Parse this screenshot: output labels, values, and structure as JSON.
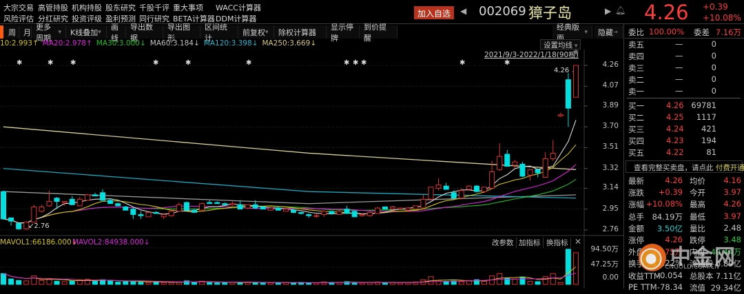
{
  "menu_row1": [
    "大宗交易",
    "高管持股",
    "机构持股",
    "股东研究",
    "千股千评",
    "重大事项",
    "WACC计算器"
  ],
  "menu_row2": [
    "风险评估",
    "分红研究",
    "投资评级",
    "盈利预测",
    "同行研究",
    "BETA计算器",
    "DDM计算器"
  ],
  "header": {
    "add_watch": "加入自选",
    "code": "002069",
    "name": "獐子岛",
    "price": "4.26",
    "change": "+0.39",
    "change_pct": "+10.08%"
  },
  "toolbar": {
    "items": [
      "周",
      "月",
      "更多周期",
      "K线叠加",
      "画线",
      "导出数据",
      "导出图形",
      "区间统计",
      "前复权",
      "除权计算器",
      "显示停牌",
      "到价提醒"
    ],
    "layout": "经典版面",
    "hide": "隐藏"
  },
  "ma_legend": [
    {
      "text": "10:2.993↑",
      "color": "#d4c400"
    },
    {
      "text": "MA20:2.978↑",
      "color": "#e020e0"
    },
    {
      "text": "MA30:3.000↓",
      "color": "#20c020"
    },
    {
      "text": "MA60:3.184↓",
      "color": "#c0c0c0"
    },
    {
      "text": "MA120:3.398↓",
      "color": "#20b8d0"
    },
    {
      "text": "MA250:3.669↓",
      "color": "#d8c880"
    }
  ],
  "chart": {
    "set_ma": "设置均线",
    "range": "2021/9/3-2022/1/18(90根)",
    "high_label": "4.26",
    "low_label": "2.76",
    "price_ticks": [
      "4.26",
      "4.07",
      "3.89",
      "3.70",
      "3.51",
      "3.32",
      "3.14",
      "2.95",
      "2.76"
    ],
    "candles": [
      [
        3.11,
        3.12,
        2.86,
        2.86
      ],
      [
        2.87,
        2.87,
        2.8,
        2.84
      ],
      [
        2.82,
        2.82,
        2.76,
        2.77
      ],
      [
        2.77,
        2.84,
        2.76,
        2.83
      ],
      [
        2.83,
        2.99,
        2.83,
        2.97
      ],
      [
        2.93,
        2.99,
        2.92,
        2.97
      ],
      [
        2.98,
        3.12,
        2.97,
        3.02
      ],
      [
        3.05,
        3.06,
        2.95,
        3.02
      ],
      [
        3.01,
        3.02,
        2.98,
        3.02
      ],
      [
        3.04,
        3.07,
        2.99,
        2.99
      ],
      [
        2.98,
        3.06,
        2.98,
        3.04
      ],
      [
        3.03,
        3.09,
        3.03,
        3.08
      ],
      [
        3.08,
        3.1,
        3.07,
        3.07
      ],
      [
        3.1,
        3.13,
        3.03,
        3.03
      ],
      [
        3.03,
        3.04,
        3.0,
        3.0
      ],
      [
        3.0,
        3.01,
        2.98,
        2.98
      ],
      [
        2.97,
        2.98,
        2.94,
        2.94
      ],
      [
        2.95,
        2.96,
        2.86,
        2.9
      ],
      [
        2.9,
        2.93,
        2.86,
        2.89
      ],
      [
        2.88,
        2.92,
        2.88,
        2.92
      ],
      [
        2.92,
        2.93,
        2.91,
        2.91
      ],
      [
        2.88,
        2.91,
        2.86,
        2.9
      ],
      [
        2.89,
        2.94,
        2.88,
        2.93
      ],
      [
        2.93,
        3.01,
        2.93,
        2.99
      ],
      [
        3.01,
        3.02,
        2.94,
        2.94
      ],
      [
        2.94,
        2.95,
        2.92,
        2.92
      ],
      [
        2.94,
        3.01,
        2.93,
        3.0
      ],
      [
        3.01,
        3.03,
        3.0,
        3.0
      ],
      [
        3.01,
        3.02,
        3.0,
        3.0
      ],
      [
        3.0,
        3.01,
        2.99,
        2.99
      ],
      [
        2.99,
        3.02,
        2.98,
        3.0
      ],
      [
        2.99,
        3.03,
        2.95,
        2.95
      ],
      [
        2.96,
        2.99,
        2.95,
        2.99
      ],
      [
        2.99,
        3.03,
        2.95,
        2.96
      ],
      [
        2.97,
        2.98,
        2.95,
        2.95
      ],
      [
        2.94,
        2.97,
        2.94,
        2.96
      ],
      [
        2.96,
        2.97,
        2.94,
        2.94
      ],
      [
        2.93,
        2.95,
        2.93,
        2.95
      ],
      [
        2.94,
        2.95,
        2.91,
        2.92
      ],
      [
        2.92,
        2.92,
        2.9,
        2.91
      ],
      [
        2.9,
        2.91,
        2.87,
        2.89
      ],
      [
        2.89,
        2.91,
        2.87,
        2.89
      ],
      [
        2.9,
        2.94,
        2.88,
        2.93
      ],
      [
        2.93,
        2.93,
        2.9,
        2.91
      ],
      [
        2.9,
        2.94,
        2.9,
        2.93
      ],
      [
        2.95,
        2.98,
        2.91,
        2.91
      ],
      [
        2.93,
        2.94,
        2.88,
        2.88
      ],
      [
        2.89,
        2.91,
        2.88,
        2.9
      ],
      [
        2.89,
        2.93,
        2.88,
        2.92
      ],
      [
        2.91,
        2.97,
        2.91,
        2.96
      ],
      [
        2.97,
        2.97,
        2.95,
        2.95
      ],
      [
        2.95,
        2.98,
        2.94,
        2.97
      ],
      [
        2.95,
        2.96,
        2.94,
        2.96
      ],
      [
        2.94,
        2.97,
        2.94,
        2.96
      ],
      [
        2.95,
        2.98,
        2.95,
        2.98
      ],
      [
        2.96,
        3.08,
        2.95,
        3.04
      ],
      [
        3.04,
        3.15,
        3.03,
        3.15
      ],
      [
        3.14,
        3.23,
        3.12,
        3.17
      ],
      [
        3.16,
        3.19,
        3.13,
        3.13
      ],
      [
        3.1,
        3.12,
        3.05,
        3.05
      ],
      [
        3.05,
        3.14,
        3.04,
        3.12
      ],
      [
        3.13,
        3.17,
        3.12,
        3.16
      ],
      [
        3.16,
        3.17,
        3.1,
        3.11
      ],
      [
        3.11,
        3.15,
        3.1,
        3.15
      ],
      [
        3.14,
        3.39,
        3.13,
        3.29
      ],
      [
        3.31,
        3.55,
        3.3,
        3.43
      ],
      [
        3.45,
        3.49,
        3.34,
        3.34
      ],
      [
        3.35,
        3.4,
        3.32,
        3.38
      ],
      [
        3.36,
        3.38,
        3.24,
        3.25
      ],
      [
        3.26,
        3.31,
        3.21,
        3.31
      ],
      [
        3.31,
        3.31,
        3.24,
        3.28
      ],
      [
        3.24,
        3.47,
        3.24,
        3.41
      ],
      [
        3.41,
        3.58,
        3.39,
        3.46
      ],
      [
        3.8,
        3.83,
        3.79,
        3.81
      ],
      [
        4.13,
        4.19,
        3.7,
        3.87
      ],
      [
        3.97,
        4.26,
        3.97,
        4.26
      ]
    ],
    "long_ma": [
      {
        "color": "#9a9a9a",
        "points": [
          [
            0,
            3.11
          ],
          [
            40,
            3.0
          ],
          [
            75,
            3.08
          ]
        ]
      },
      {
        "color": "#1aa8c0",
        "points": [
          [
            0,
            3.32
          ],
          [
            40,
            3.11
          ],
          [
            75,
            3.05
          ]
        ]
      },
      {
        "color": "#d8d090",
        "points": [
          [
            0,
            3.7
          ],
          [
            40,
            3.46
          ],
          [
            75,
            3.31
          ]
        ]
      }
    ],
    "colors": {
      "up": "#e03030",
      "down": "#00e0e0",
      "ma5": "#dddddd",
      "ma10": "#d4c400",
      "ma20": "#e020e0",
      "ma30": "#20c020"
    }
  },
  "volume": {
    "mavol1": "MAVOL1:66186.000↓",
    "mavol2": "MAVOL2:84938.000↓",
    "ticks": [
      "94.50万",
      "47.25万",
      "0.00"
    ],
    "max": 94.5,
    "values": [
      28,
      14,
      10,
      9,
      22,
      10,
      14,
      8,
      7,
      9,
      12,
      13,
      8,
      12,
      9,
      6,
      7,
      8,
      7,
      5,
      6,
      5,
      5,
      6,
      9,
      6,
      8,
      5,
      4,
      5,
      5,
      5,
      6,
      5,
      5,
      4,
      4,
      5,
      4,
      5,
      4,
      4,
      6,
      5,
      5,
      7,
      5,
      4,
      5,
      6,
      4,
      5,
      4,
      5,
      6,
      12,
      20,
      10,
      8,
      9,
      7,
      10,
      12,
      8,
      22,
      28,
      16,
      14,
      18,
      8,
      7,
      20,
      28,
      5,
      91,
      82
    ],
    "buttons": [
      "改参数",
      "加指标",
      "换指标"
    ]
  },
  "order_book": {
    "wb_label": "委比",
    "wb": "100.00%",
    "wc_label": "委差",
    "wc": "7.16万",
    "sell": [
      {
        "label": "卖五",
        "price": "—",
        "vol": "0"
      },
      {
        "label": "卖四",
        "price": "—",
        "vol": "0"
      },
      {
        "label": "卖三",
        "price": "—",
        "vol": "0"
      },
      {
        "label": "卖二",
        "price": "—",
        "vol": "0"
      },
      {
        "label": "卖一",
        "price": "—",
        "vol": "0"
      }
    ],
    "buy": [
      {
        "label": "买一",
        "price": "4.26",
        "vol": "69781"
      },
      {
        "label": "买二",
        "price": "4.25",
        "vol": "1117"
      },
      {
        "label": "买三",
        "price": "4.24",
        "vol": "421"
      },
      {
        "label": "买四",
        "price": "4.23",
        "vol": "194"
      },
      {
        "label": "买五",
        "price": "4.22",
        "vol": "81"
      }
    ],
    "note": "查看完整买卖盘，请点此",
    "note_link": "付费开通"
  },
  "stats": [
    {
      "l1": "最新",
      "v1": "4.26",
      "c1": "red",
      "l2": "均价",
      "v2": "4.16",
      "c2": "red"
    },
    {
      "l1": "涨跌",
      "v1": "+0.39",
      "c1": "red",
      "l2": "今开",
      "v2": "3.97",
      "c2": "red"
    },
    {
      "l1": "涨幅",
      "v1": "+10.08%",
      "c1": "red",
      "l2": "最高",
      "v2": "4.26",
      "c2": "red"
    },
    {
      "l1": "总手",
      "v1": "84.19万",
      "c1": "",
      "l2": "最低",
      "v2": "3.97",
      "c2": "red"
    },
    {
      "l1": "金额",
      "v1": "3.50亿",
      "c1": "cyn",
      "l2": "量比",
      "v2": "2.48",
      "c2": ""
    },
    {
      "l1": "涨停",
      "v1": "4.26",
      "c1": "red",
      "l2": "跌停",
      "v2": "3.48",
      "c2": "grn"
    },
    {
      "l1": "外盘",
      "v1": "43.75万",
      "c1": "red",
      "l2": "内盘",
      "v2": "40.44万",
      "c2": "grn"
    },
    {
      "l1": "换手",
      "v1": "12.22%",
      "c1": "",
      "l2": "流通股",
      "v2": "6.89亿",
      "c2": ""
    },
    {
      "l1": "收益TTM",
      "v1": "-0.054",
      "c1": "",
      "l2": "总股本",
      "v2": "7.11亿",
      "c2": ""
    },
    {
      "l1": "PE TTM",
      "v1": "-78.34",
      "c1": "",
      "l2": "流值",
      "v2": "29.34亿",
      "c2": ""
    }
  ],
  "watermark": {
    "text": "中金网",
    "sub": "CNGOLD.COM.CN"
  }
}
